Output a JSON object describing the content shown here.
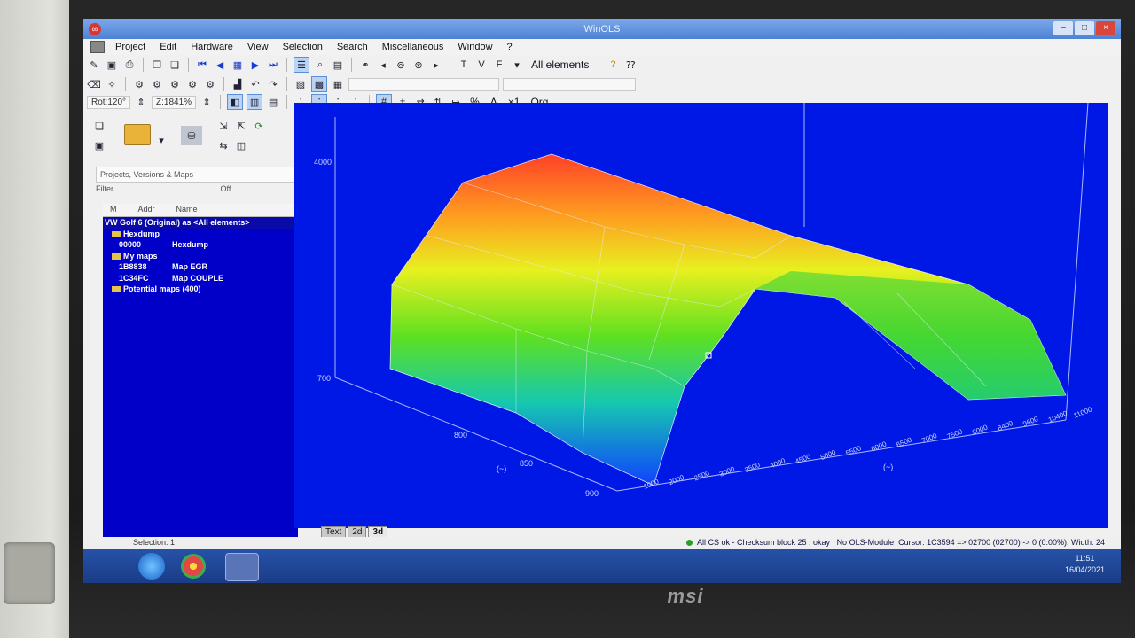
{
  "window": {
    "title": "WinOLS",
    "app_icon": "winols-logo-icon"
  },
  "menu": [
    "Project",
    "Edit",
    "Hardware",
    "View",
    "Selection",
    "Search",
    "Miscellaneous",
    "Window",
    "?"
  ],
  "toolbar1": {
    "all_elements_label": "All elements"
  },
  "toolbar3": {
    "rot": "Rot:120°",
    "zoom": "Z:1841%",
    "pct": "%",
    "delta": "Δ",
    "x1": "×1",
    "org": "Org"
  },
  "left_panel": {
    "pane_title": "Projects, Versions & Maps",
    "filter_label": "Filter",
    "filter_off": "Off",
    "headers": [
      "M",
      "Addr",
      "Name"
    ],
    "rows": [
      {
        "text": "VW Golf 6 (Original) as <All elements>",
        "indent": 0,
        "folder": false
      },
      {
        "text": "Hexdump",
        "indent": 1,
        "folder": true
      },
      {
        "addr": "00000",
        "name": "Hexdump",
        "indent": 2
      },
      {
        "text": "My maps",
        "indent": 1,
        "folder": true
      },
      {
        "addr": "1B8838",
        "name": "Map EGR",
        "indent": 2
      },
      {
        "addr": "1C34FC",
        "name": "Map COUPLE",
        "indent": 2
      },
      {
        "text": "Potential maps (400)",
        "indent": 1,
        "folder": true
      }
    ]
  },
  "view3d": {
    "z_labels": [
      "4000",
      "700"
    ],
    "x_labels": [
      "800",
      "850",
      "900"
    ],
    "x_unit": "(~)",
    "y_labels": [
      "1000",
      "2000",
      "2500",
      "3000",
      "3500",
      "4000",
      "4500",
      "5000",
      "5500",
      "6000",
      "6500",
      "7000",
      "7500",
      "8000",
      "8400",
      "9600",
      "10400",
      "11000"
    ],
    "y_unit": "(~)"
  },
  "tabs": [
    "Text",
    "2d",
    "3d"
  ],
  "status": {
    "selection": "Selection: 1",
    "checksum": "All CS ok - Checksum block 25 : okay",
    "ols": "No OLS-Module",
    "cursor": "Cursor: 1C3594 => 02700 (02700) -> 0 (0.00%), Width: 24"
  },
  "clock": {
    "time": "11:51",
    "date": "16/04/2021"
  },
  "colors": {
    "view_bg": "#0018e6",
    "tree_bg": "#0000c8"
  }
}
